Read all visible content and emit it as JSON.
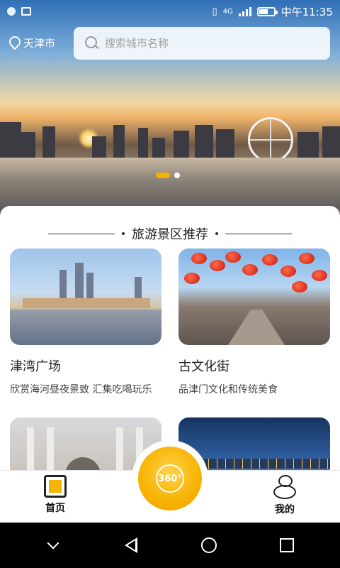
{
  "status_bar": {
    "time": "中午11:35",
    "network": "4G"
  },
  "header": {
    "city": "天津市",
    "search": {
      "placeholder": "搜索城市名称",
      "value": ""
    }
  },
  "banner": {
    "pages": 2,
    "active_page": 1
  },
  "section": {
    "title": "旅游景区推荐"
  },
  "attractions": [
    {
      "name": "津湾广场",
      "desc": "欣赏海河昼夜景致 汇集吃喝玩乐"
    },
    {
      "name": "古文化街",
      "desc": "品津门文化和传统美食"
    },
    {
      "name": "",
      "desc": ""
    },
    {
      "name": "",
      "desc": ""
    }
  ],
  "tabbar": {
    "home_label": "首页",
    "vr_label": "360°",
    "mine_label": "我的"
  },
  "colors": {
    "accent": "#f5b400",
    "text": "#222222"
  }
}
